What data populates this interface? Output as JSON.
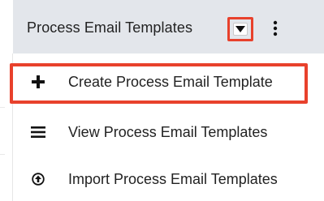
{
  "module_tab": {
    "label": "Process Email Templates",
    "caret_icon": "caret-down-icon",
    "more_icon": "kebab-vertical-icon"
  },
  "menu": {
    "items": [
      {
        "label": "Create Process Email Template",
        "icon": "plus-icon"
      },
      {
        "label": "View Process Email Templates",
        "icon": "list-icon"
      },
      {
        "label": "Import Process Email Templates",
        "icon": "upload-circle-icon"
      }
    ]
  },
  "colors": {
    "highlight": "#e8412c",
    "tabbar_bg": "#e3e6eb",
    "text": "#222222"
  }
}
